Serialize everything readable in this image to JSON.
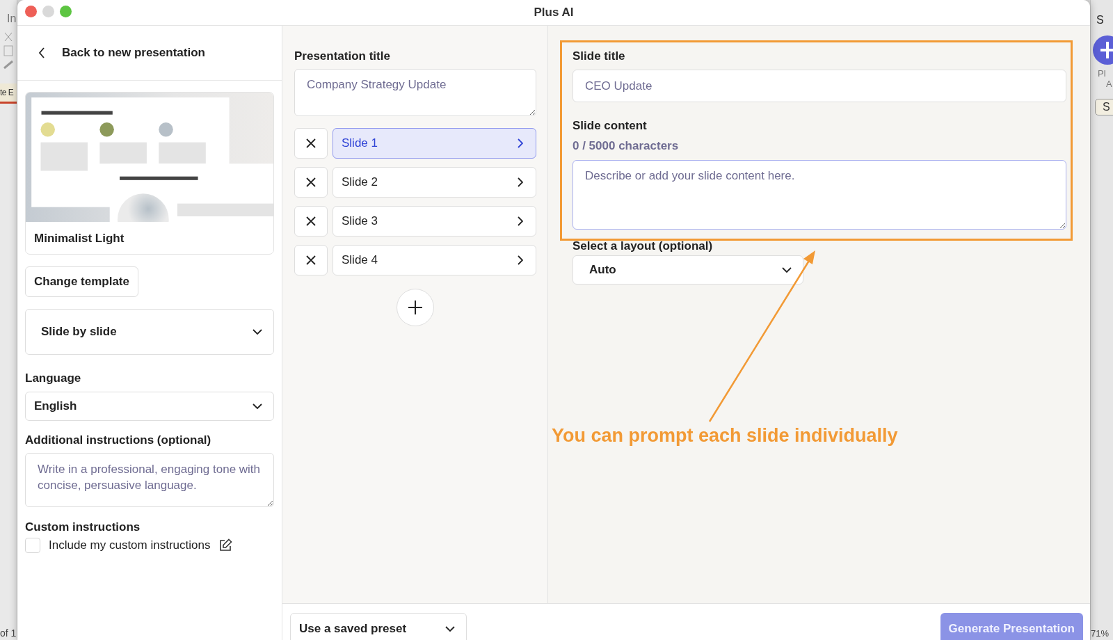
{
  "background_app": {
    "left_texts": [
      "In",
      "te E",
      "of 1"
    ],
    "right_texts": [
      "S",
      "Pl",
      "A",
      "S",
      "71%"
    ]
  },
  "window": {
    "title": "Plus AI"
  },
  "sidebar": {
    "back_link": "Back to new presentation",
    "template": {
      "name": "Minimalist Light"
    },
    "change_template_button": "Change template",
    "mode_select": "Slide by slide",
    "language": {
      "label": "Language",
      "value": "English"
    },
    "additional_instructions": {
      "label": "Additional instructions (optional)",
      "placeholder": "Write in a professional, engaging tone with concise, persuasive language."
    },
    "custom_instructions": {
      "label": "Custom instructions",
      "checkbox_label": "Include my custom instructions",
      "checked": false
    }
  },
  "outline": {
    "title_label": "Presentation title",
    "title_placeholder": "Company Strategy Update",
    "slides": [
      {
        "label": "Slide 1",
        "selected": true
      },
      {
        "label": "Slide 2",
        "selected": false
      },
      {
        "label": "Slide 3",
        "selected": false
      },
      {
        "label": "Slide 4",
        "selected": false
      }
    ]
  },
  "editor": {
    "title_label": "Slide title",
    "title_placeholder": "CEO Update",
    "content_label": "Slide content",
    "counter": "0 / 5000 characters",
    "content_placeholder": "Describe or add your slide content here.",
    "layout_label": "Select a layout (optional)",
    "layout_value": "Auto"
  },
  "annotation": {
    "text": "You can prompt each slide individually"
  },
  "footer": {
    "preset_select": "Use a saved preset",
    "generate_button": "Generate Presentation",
    "disabled": true
  }
}
